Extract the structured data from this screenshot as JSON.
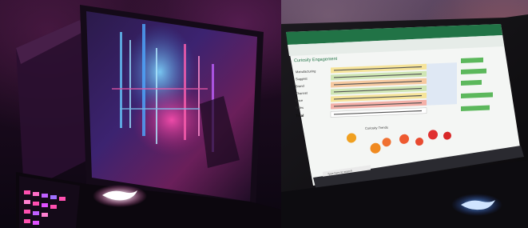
{
  "left_photo": {
    "description_icon": "laptop-rog-icon"
  },
  "right_photo": {
    "spreadsheet": {
      "title": "Curiosity Engagement",
      "rows": [
        "Manufacturing",
        "Suggest",
        "Brand",
        "Channel",
        "Price",
        "Sales",
        "Total"
      ],
      "chart_title": "Curiosity Trends"
    },
    "taskbar_search": "Type here to search",
    "brand": "ROG"
  },
  "colors": {
    "rog_magenta": "#e0318a",
    "excel_green": "#217346",
    "bubble_orange": "#f0a020",
    "bubble_red": "#e03030"
  }
}
